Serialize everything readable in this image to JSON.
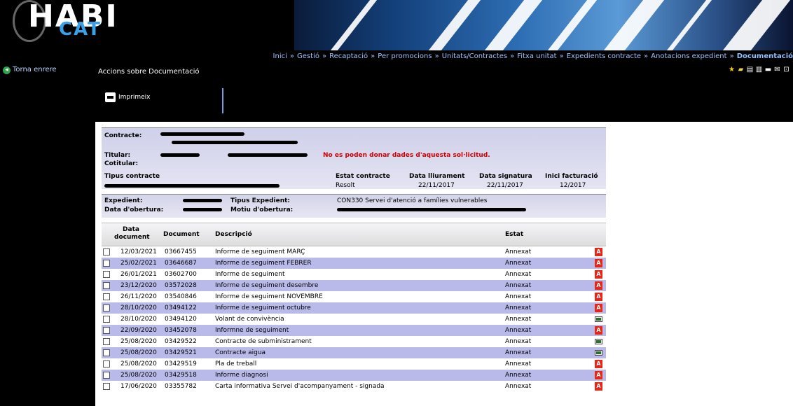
{
  "header": {
    "logo_big": "HABI",
    "logo_small": "CAT",
    "breadcrumbs": [
      "Inici",
      "Gestió",
      "Recaptació",
      "Per promocions",
      "Unitats/Contractes",
      "Fitxa unitat",
      "Expedients contracte",
      "Anotacions expedient",
      "Documentació"
    ],
    "breadcrumb_separator": "»"
  },
  "sidebar": {
    "back_label": "Torna enrere"
  },
  "actions": {
    "title": "Accions sobre Documentació",
    "print_label": "Imprimeix"
  },
  "toolbar_icons": [
    "star-icon",
    "folder-icon",
    "list-icon",
    "document-icon",
    "print-icon",
    "mail-icon",
    "exit-icon"
  ],
  "contract": {
    "contracte_label": "Contracte:",
    "titular_label": "Titular:",
    "cotitular_label": "Cotitular:",
    "error_message": "No es poden donar dades d'aquesta sol·licitud.",
    "tipus_label": "Tipus contracte",
    "estat_label": "Estat contracte",
    "lliurament_label": "Data lliurament",
    "signatura_label": "Data signatura",
    "facturacio_label": "Inici facturació",
    "estat_value": "Resolt",
    "lliurament_value": "22/11/2017",
    "signatura_value": "22/11/2017",
    "facturacio_value": "12/2017"
  },
  "expedient": {
    "expedient_label": "Expedient:",
    "obertura_label": "Data d'obertura:",
    "tipus_label": "Tipus Expedient:",
    "motiu_label": "Motiu d'obertura:",
    "tipus_value": "CON330 Servei d'atenció a famílies vulnerables"
  },
  "table": {
    "headers": {
      "data": "Data document",
      "document": "Document",
      "descripcio": "Descripció",
      "estat": "Estat"
    },
    "rows": [
      {
        "date": "12/03/2021",
        "doc": "03667455",
        "desc": "Informe de seguiment MARÇ",
        "status": "Annexat",
        "icon": "pdf"
      },
      {
        "date": "25/02/2021",
        "doc": "03646687",
        "desc": "Informe de seguiment FEBRER",
        "status": "Annexat",
        "icon": "pdf"
      },
      {
        "date": "26/01/2021",
        "doc": "03602700",
        "desc": "Informe de seguiment",
        "status": "Annexat",
        "icon": "pdf"
      },
      {
        "date": "23/12/2020",
        "doc": "03572028",
        "desc": "Informe de seguiment desembre",
        "status": "Annexat",
        "icon": "pdf"
      },
      {
        "date": "26/11/2020",
        "doc": "03540846",
        "desc": "Informe de seguiment NOVEMBRE",
        "status": "Annexat",
        "icon": "pdf"
      },
      {
        "date": "28/10/2020",
        "doc": "03494122",
        "desc": "Informe de seguiment octubre",
        "status": "Annexat",
        "icon": "pdf"
      },
      {
        "date": "28/10/2020",
        "doc": "03494120",
        "desc": "Volant de convivència",
        "status": "Annexat",
        "icon": "image"
      },
      {
        "date": "22/09/2020",
        "doc": "03452078",
        "desc": "Informne de seguiment",
        "status": "Annexat",
        "icon": "pdf"
      },
      {
        "date": "25/08/2020",
        "doc": "03429522",
        "desc": "Contracte de subministrament",
        "status": "Annexat",
        "icon": "image"
      },
      {
        "date": "25/08/2020",
        "doc": "03429521",
        "desc": "Contracte aigua",
        "status": "Annexat",
        "icon": "image"
      },
      {
        "date": "25/08/2020",
        "doc": "03429519",
        "desc": "Pla de treball",
        "status": "Annexat",
        "icon": "pdf"
      },
      {
        "date": "25/08/2020",
        "doc": "03429518",
        "desc": "Informe diagnosi",
        "status": "Annexat",
        "icon": "pdf"
      },
      {
        "date": "17/06/2020",
        "doc": "03355782",
        "desc": "Carta informativa Servei d'acompanyament - signada",
        "status": "Annexat",
        "icon": "pdf"
      }
    ]
  }
}
